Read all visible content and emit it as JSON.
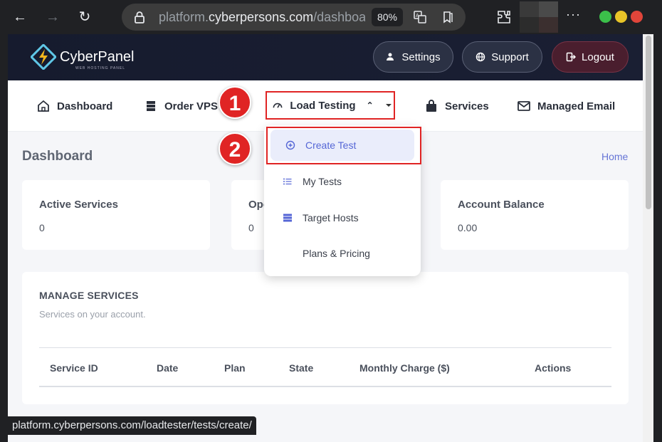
{
  "browser": {
    "url_host_prefix": "platform.",
    "url_host_main": "cyberpersons.com",
    "url_path": "/dashboard",
    "zoom": "80%",
    "status_url": "platform.cyberpersons.com/loadtester/tests/create/"
  },
  "header": {
    "logo_text": "CyberPanel",
    "logo_subtext": "WEB HOSTING PANEL",
    "settings_label": "Settings",
    "support_label": "Support",
    "logout_label": "Logout"
  },
  "nav": {
    "items": [
      {
        "label": "Dashboard",
        "icon": "home-icon"
      },
      {
        "label": "Order VPS",
        "icon": "server-icon"
      },
      {
        "label": "Load Testing",
        "icon": "gauge-icon"
      },
      {
        "label": "Services",
        "icon": "shopping-bag-icon"
      },
      {
        "label": "Managed Email",
        "icon": "mail-icon"
      }
    ]
  },
  "dropdown": {
    "items": [
      {
        "label": "Create Test",
        "icon": "plus-circle-icon",
        "active": true
      },
      {
        "label": "My Tests",
        "icon": "list-icon"
      },
      {
        "label": "Target Hosts",
        "icon": "server-icon"
      },
      {
        "label": "Plans & Pricing",
        "icon": ""
      }
    ]
  },
  "annotations": {
    "step1": "1",
    "step2": "2"
  },
  "page": {
    "title": "Dashboard",
    "breadcrumb": "Home"
  },
  "cards": [
    {
      "title": "Active Services",
      "value": "0"
    },
    {
      "title": "Ope",
      "value": "0"
    },
    {
      "title": "Account Balance",
      "value": "0.00"
    }
  ],
  "manage": {
    "title": "MANAGE SERVICES",
    "subtitle": "Services on your account.",
    "columns": [
      "Service ID",
      "Date",
      "Plan",
      "State",
      "Monthly Charge ($)",
      "Actions"
    ]
  },
  "colors": {
    "accent": "#5566d6",
    "annotation_red": "#e02424",
    "header_bg": "#161b2e"
  }
}
